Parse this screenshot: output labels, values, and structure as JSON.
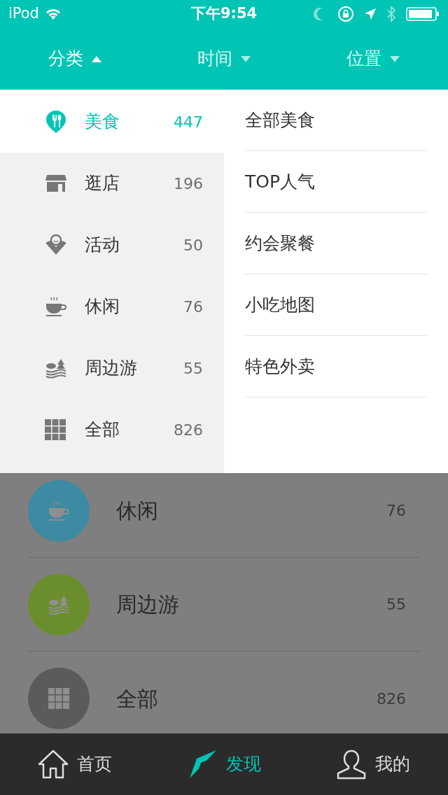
{
  "status_bar": {
    "carrier": "iPod",
    "time": "下午9:54"
  },
  "filter_tabs": [
    {
      "label": "分类",
      "selected": true
    },
    {
      "label": "时间",
      "selected": false
    },
    {
      "label": "位置",
      "selected": false
    }
  ],
  "categories": [
    {
      "name": "美食",
      "count": "447",
      "selected": true
    },
    {
      "name": "逛店",
      "count": "196",
      "selected": false
    },
    {
      "name": "活动",
      "count": "50",
      "selected": false
    },
    {
      "name": "休闲",
      "count": "76",
      "selected": false
    },
    {
      "name": "周边游",
      "count": "55",
      "selected": false
    },
    {
      "name": "全部",
      "count": "826",
      "selected": false
    }
  ],
  "subcategories": [
    "全部美食",
    "TOP人气",
    "约会聚餐",
    "小吃地图",
    "特色外卖"
  ],
  "background_list": [
    {
      "name": "休闲",
      "count": "76",
      "color": "#3d8aa3"
    },
    {
      "name": "周边游",
      "count": "55",
      "color": "#6b8e2c"
    },
    {
      "name": "全部",
      "count": "826",
      "color": "#5b5b5b"
    }
  ],
  "tab_bar": [
    {
      "label": "首页",
      "selected": false
    },
    {
      "label": "发现",
      "selected": true
    },
    {
      "label": "我的",
      "selected": false
    }
  ]
}
